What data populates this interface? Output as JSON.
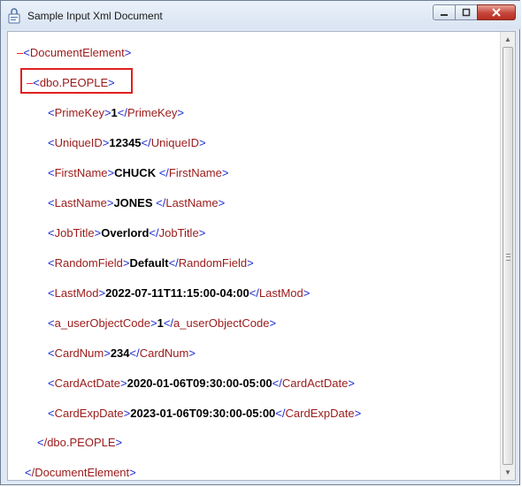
{
  "window": {
    "title": "Sample Input Xml Document",
    "buttons": {
      "minimize": "–",
      "maximize": "□",
      "close": "✕"
    }
  },
  "xml": {
    "root_open": "DocumentElement",
    "root_close": "/DocumentElement",
    "record_open": "dbo.PEOPLE",
    "record_close": "/dbo.PEOPLE",
    "collapse_symbol": "–",
    "fields": [
      {
        "name": "PrimeKey",
        "value": "1"
      },
      {
        "name": "UniqueID",
        "value": "12345"
      },
      {
        "name": "FirstName",
        "value": "CHUCK "
      },
      {
        "name": "LastName",
        "value": "JONES "
      },
      {
        "name": "JobTitle",
        "value": "Overlord"
      },
      {
        "name": "RandomField",
        "value": "Default"
      },
      {
        "name": "LastMod",
        "value": "2022-07-11T11:15:00-04:00"
      },
      {
        "name": "a_userObjectCode",
        "value": "1"
      },
      {
        "name": "CardNum",
        "value": "234"
      },
      {
        "name": "CardActDate",
        "value": "2020-01-06T09:30:00-05:00"
      },
      {
        "name": "CardExpDate",
        "value": "2023-01-06T09:30:00-05:00"
      }
    ]
  },
  "colors": {
    "tag": "#9b1a1a",
    "bracket": "#1a2bd0",
    "value": "#000000",
    "collapse": "#ff0000",
    "highlight_box": "#e02020"
  },
  "scrollbar": {
    "up_arrow": "▲",
    "down_arrow": "▼"
  }
}
